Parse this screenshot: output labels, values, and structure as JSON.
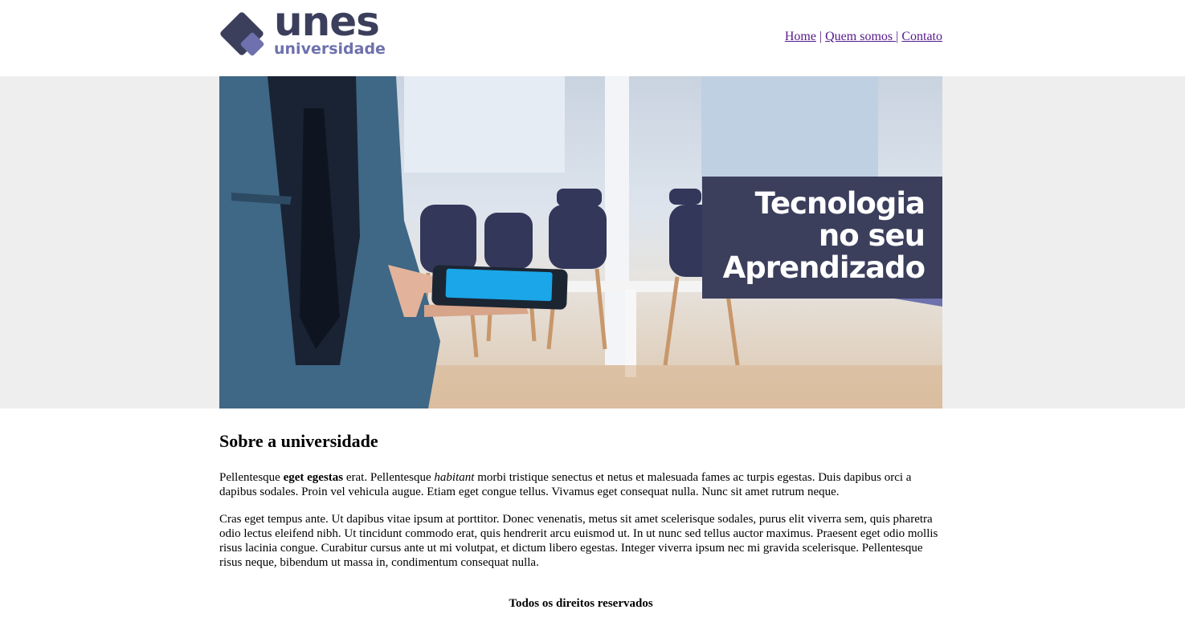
{
  "brand": {
    "name": "unes",
    "subtitle": "universidade",
    "colors": {
      "primary": "#3b3f5c",
      "accent": "#6e71ad",
      "link": "#551a8b",
      "band": "#eeeeee"
    }
  },
  "nav": {
    "items": [
      {
        "label": "Home"
      },
      {
        "label": "Quem somos "
      },
      {
        "label": "Contato"
      }
    ],
    "separator": "|"
  },
  "banner": {
    "caption_line1": "Tecnologia",
    "caption_line2": "no seu",
    "caption_line3": "Aprendizado"
  },
  "about": {
    "title": "Sobre a universidade",
    "p1_part1": "Pellentesque ",
    "p1_bold": "eget egestas",
    "p1_part2": " erat. Pellentesque ",
    "p1_italic": "habitant",
    "p1_part3": " morbi tristique senectus et netus et malesuada fames ac turpis egestas. Duis dapibus orci a dapibus sodales. Proin vel vehicula augue. Etiam eget congue tellus. Vivamus eget consequat nulla. Nunc sit amet rutrum neque.",
    "p2": "Cras eget tempus ante. Ut dapibus vitae ipsum at porttitor. Donec venenatis, metus sit amet scelerisque sodales, purus elit viverra sem, quis pharetra odio lectus eleifend nibh. Ut tincidunt commodo erat, quis hendrerit arcu euismod ut. In ut nunc sed tellus auctor maximus. Praesent eget odio mollis risus lacinia congue. Curabitur cursus ante ut mi volutpat, et dictum libero egestas. Integer viverra ipsum nec mi gravida scelerisque. Pellentesque risus neque, bibendum ut massa in, condimentum consequat nulla."
  },
  "footer": {
    "text": "Todos os direitos reservados"
  }
}
